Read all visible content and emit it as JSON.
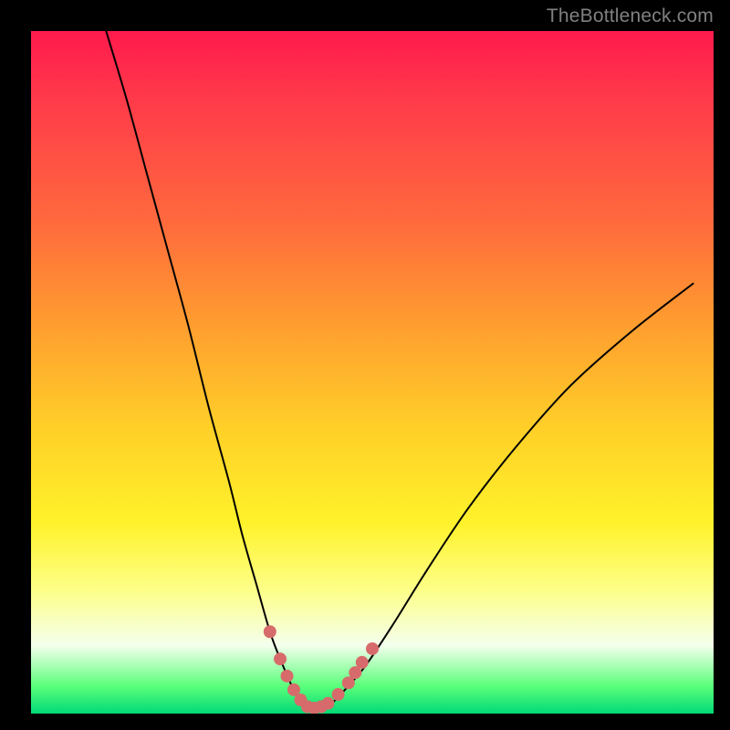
{
  "watermark": "TheBottleneck.com",
  "chart_data": {
    "type": "line",
    "title": "",
    "xlabel": "",
    "ylabel": "",
    "xlim": [
      0,
      100
    ],
    "ylim": [
      0,
      100
    ],
    "grid": false,
    "legend": false,
    "series": [
      {
        "name": "bottleneck-curve",
        "color": "#000000",
        "x": [
          11,
          14,
          17,
          20,
          23,
          26,
          29,
          31,
          33,
          35,
          36.5,
          38,
          39,
          40,
          41,
          42,
          44,
          46,
          49,
          53,
          58,
          64,
          71,
          79,
          88,
          97
        ],
        "y": [
          100,
          90,
          79,
          68,
          57,
          45,
          34,
          26,
          19,
          12,
          8,
          4.5,
          2.5,
          1.2,
          0.8,
          0.8,
          1.5,
          3.5,
          7,
          13,
          21,
          30,
          39,
          48,
          56,
          63
        ]
      }
    ],
    "markers": {
      "name": "highlight-points",
      "color": "#d76b6b",
      "radius_primary": 7,
      "points": [
        {
          "x": 35.0,
          "y": 12.0
        },
        {
          "x": 36.5,
          "y": 8.0
        },
        {
          "x": 37.5,
          "y": 5.5
        },
        {
          "x": 38.5,
          "y": 3.5
        },
        {
          "x": 39.5,
          "y": 2.0
        },
        {
          "x": 40.5,
          "y": 1.0
        },
        {
          "x": 41.5,
          "y": 0.8
        },
        {
          "x": 42.5,
          "y": 1.0
        },
        {
          "x": 43.5,
          "y": 1.5
        },
        {
          "x": 45.0,
          "y": 2.8
        },
        {
          "x": 46.5,
          "y": 4.5
        },
        {
          "x": 47.5,
          "y": 6.0
        },
        {
          "x": 48.5,
          "y": 7.5
        },
        {
          "x": 50.0,
          "y": 9.5
        }
      ]
    },
    "gradient_stops": [
      {
        "pos": 0.0,
        "color": "#ff1a4d"
      },
      {
        "pos": 0.1,
        "color": "#ff3a4a"
      },
      {
        "pos": 0.28,
        "color": "#ff6a3d"
      },
      {
        "pos": 0.42,
        "color": "#ff9a30"
      },
      {
        "pos": 0.58,
        "color": "#ffcf28"
      },
      {
        "pos": 0.72,
        "color": "#fff22a"
      },
      {
        "pos": 0.82,
        "color": "#fdff89"
      },
      {
        "pos": 0.9,
        "color": "#f4ffed"
      },
      {
        "pos": 0.96,
        "color": "#5aff7a"
      },
      {
        "pos": 1.0,
        "color": "#00d977"
      }
    ]
  }
}
